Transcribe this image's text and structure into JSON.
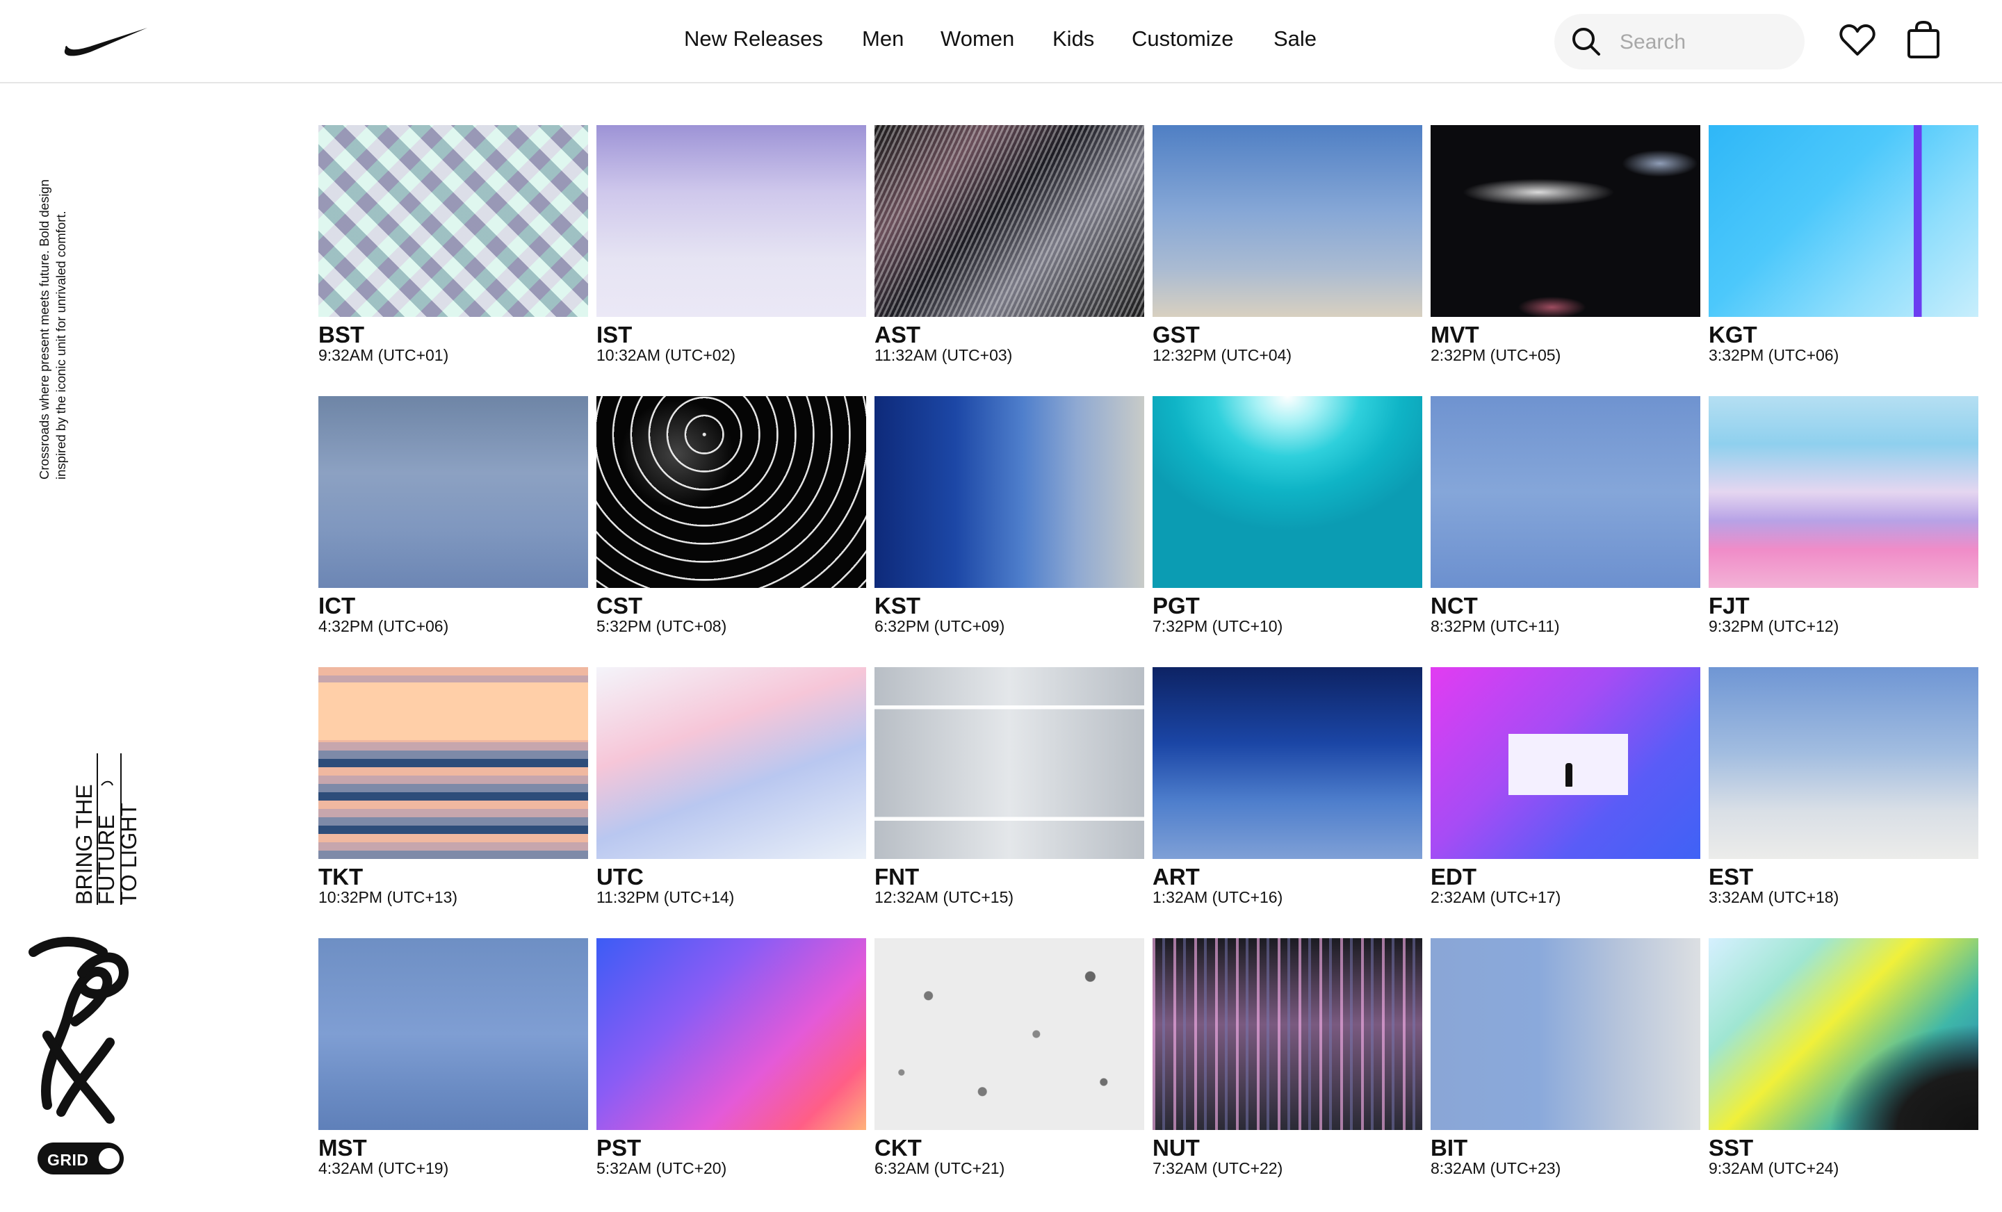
{
  "header": {
    "nav": [
      "New Releases",
      "Men",
      "Women",
      "Kids",
      "Customize",
      "Sale"
    ],
    "search_placeholder": "Search"
  },
  "sidebar": {
    "tagline": "Crossroads where present meets future. Bold design inspired by the iconic unit for unrivaled comfort.",
    "brand_lines": [
      "BRING THE",
      "FUTURE",
      "TO LIGHT"
    ],
    "toggle_label": "GRID"
  },
  "tiles": [
    {
      "code": "BST",
      "time": "9:32AM (UTC+01)"
    },
    {
      "code": "IST",
      "time": "10:32AM (UTC+02)"
    },
    {
      "code": "AST",
      "time": "11:32AM (UTC+03)"
    },
    {
      "code": "GST",
      "time": "12:32PM (UTC+04)"
    },
    {
      "code": "MVT",
      "time": "2:32PM (UTC+05)"
    },
    {
      "code": "KGT",
      "time": "3:32PM (UTC+06)"
    },
    {
      "code": "ICT",
      "time": "4:32PM (UTC+06)"
    },
    {
      "code": "CST",
      "time": "5:32PM (UTC+08)"
    },
    {
      "code": "KST",
      "time": "6:32PM (UTC+09)"
    },
    {
      "code": "PGT",
      "time": "7:32PM (UTC+10)"
    },
    {
      "code": "NCT",
      "time": "8:32PM (UTC+11)"
    },
    {
      "code": "FJT",
      "time": "9:32PM (UTC+12)"
    },
    {
      "code": "TKT",
      "time": "10:32PM (UTC+13)"
    },
    {
      "code": "UTC",
      "time": "11:32PM (UTC+14)"
    },
    {
      "code": "FNT",
      "time": "12:32AM (UTC+15)"
    },
    {
      "code": "ART",
      "time": "1:32AM (UTC+16)"
    },
    {
      "code": "EDT",
      "time": "2:32AM (UTC+17)"
    },
    {
      "code": "EST",
      "time": "3:32AM (UTC+18)"
    },
    {
      "code": "MST",
      "time": "4:32AM (UTC+19)"
    },
    {
      "code": "PST",
      "time": "5:32AM (UTC+20)"
    },
    {
      "code": "CKT",
      "time": "6:32AM (UTC+21)"
    },
    {
      "code": "NUT",
      "time": "7:32AM (UTC+22)"
    },
    {
      "code": "BIT",
      "time": "8:32AM (UTC+23)"
    },
    {
      "code": "SST",
      "time": "9:32AM (UTC+24)"
    }
  ]
}
